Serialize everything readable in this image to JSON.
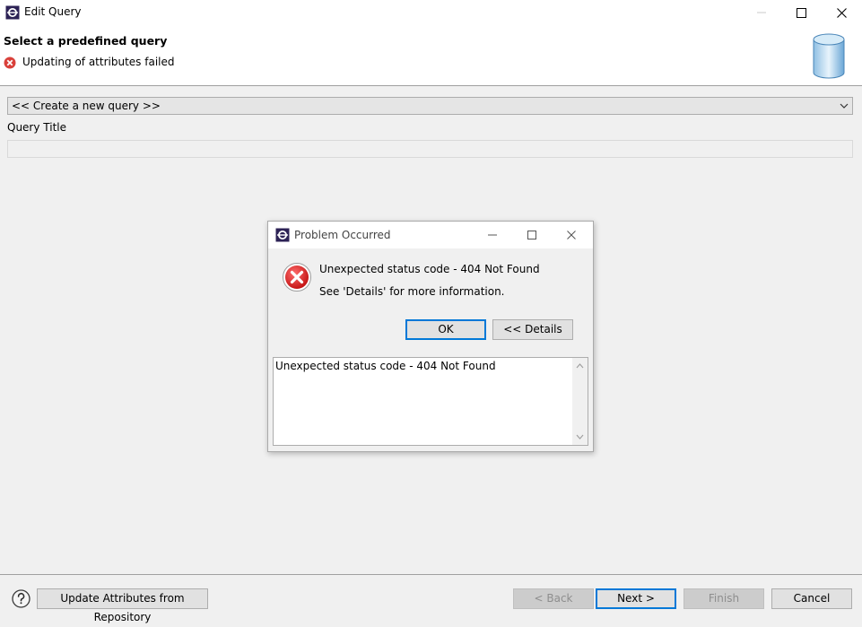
{
  "window": {
    "title": "Edit Query",
    "controls": {
      "minimize": "minimize-icon",
      "maximize": "maximize-icon",
      "close": "close-icon"
    }
  },
  "header": {
    "page_title": "Select a predefined query",
    "message": "Updating of attributes failed",
    "message_icon": "error-icon",
    "banner_icon": "database-icon"
  },
  "form": {
    "query_select_value": "<< Create a new query >>",
    "query_title_label": "Query Title",
    "query_title_value": ""
  },
  "dialog": {
    "title": "Problem Occurred",
    "message": "Unexpected status code - 404 Not Found",
    "hint": "See 'Details' for more information.",
    "ok_label": "OK",
    "details_label": "<< Details",
    "details_text": "Unexpected status code - 404 Not Found"
  },
  "footer": {
    "update_label": "Update Attributes from Repository",
    "back_label": "< Back",
    "next_label": "Next >",
    "finish_label": "Finish",
    "cancel_label": "Cancel"
  },
  "colors": {
    "accent": "#0078d7",
    "error_red": "#d9403a",
    "background": "#f0f0f0"
  }
}
